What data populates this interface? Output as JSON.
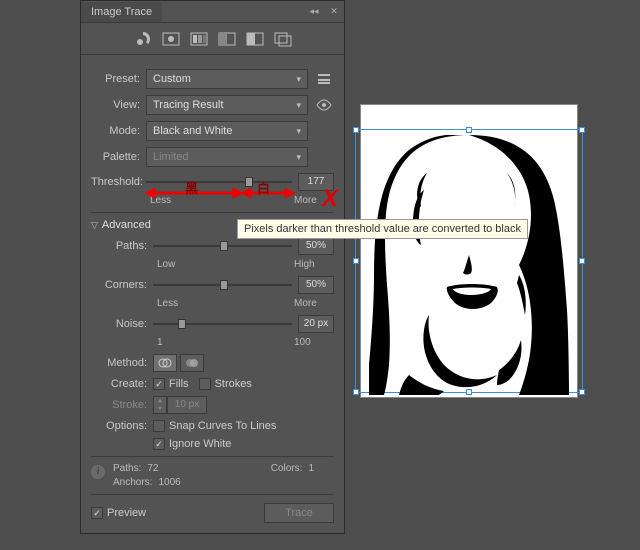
{
  "panel": {
    "title": "Image Trace",
    "preset_label": "Preset:",
    "preset_value": "Custom",
    "view_label": "View:",
    "view_value": "Tracing Result",
    "mode_label": "Mode:",
    "mode_value": "Black and White",
    "palette_label": "Palette:",
    "palette_value": "Limited",
    "threshold_label": "Threshold:",
    "threshold_value": "177",
    "threshold_min": "Less",
    "threshold_max": "More",
    "advanced_label": "Advanced",
    "paths_label": "Paths:",
    "paths_value": "50%",
    "paths_min": "Low",
    "paths_max": "High",
    "corners_label": "Corners:",
    "corners_value": "50%",
    "corners_min": "Less",
    "corners_max": "More",
    "noise_label": "Noise:",
    "noise_value": "20 px",
    "noise_min": "1",
    "noise_max": "100",
    "method_label": "Method:",
    "create_label": "Create:",
    "fills_label": "Fills",
    "strokes_label": "Strokes",
    "stroke_label": "Stroke:",
    "stroke_value": "10 px",
    "options_label": "Options:",
    "snap_label": "Snap Curves To Lines",
    "ignore_label": "Ignore White",
    "info_paths_label": "Paths:",
    "info_paths_value": "72",
    "info_colors_label": "Colors:",
    "info_colors_value": "1",
    "info_anchors_label": "Anchors:",
    "info_anchors_value": "1006",
    "preview_label": "Preview",
    "trace_btn": "Trace"
  },
  "annotations": {
    "black_char": "黑",
    "white_char": "白",
    "tooltip": "Pixels darker than threshold value are converted to black",
    "x_mark": "X"
  }
}
